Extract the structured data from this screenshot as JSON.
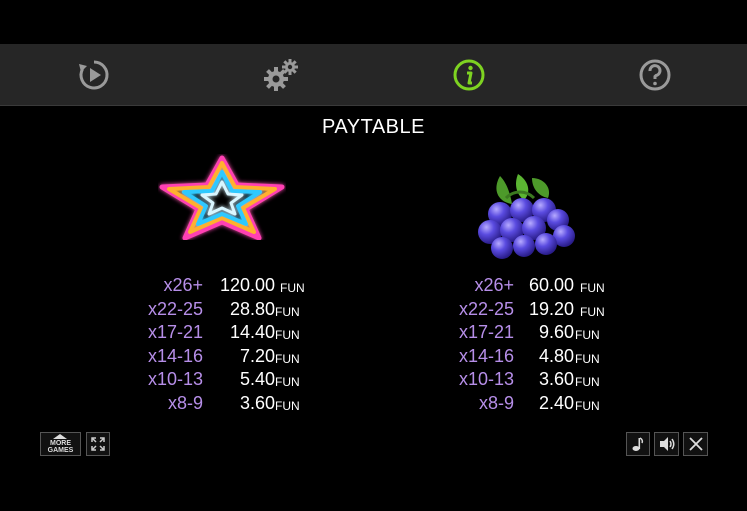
{
  "toolbar": {
    "tabs": [
      {
        "icon": "replay-icon",
        "active": false
      },
      {
        "icon": "settings-gears-icon",
        "active": false
      },
      {
        "icon": "info-icon",
        "active": true
      },
      {
        "icon": "help-icon",
        "active": false
      }
    ],
    "active_color": "#7ed321",
    "inactive_color": "#9a9a9a"
  },
  "title": "PAYTABLE",
  "currency": "FUN",
  "symbols": [
    {
      "name": "star",
      "payouts": [
        {
          "count": "x26+",
          "amount": "120.00"
        },
        {
          "count": "x22-25",
          "amount": "28.80"
        },
        {
          "count": "x17-21",
          "amount": "14.40"
        },
        {
          "count": "x14-16",
          "amount": "7.20"
        },
        {
          "count": "x10-13",
          "amount": "5.40"
        },
        {
          "count": "x8-9",
          "amount": "3.60"
        }
      ]
    },
    {
      "name": "grapes",
      "payouts": [
        {
          "count": "x26+",
          "amount": "60.00"
        },
        {
          "count": "x22-25",
          "amount": "19.20"
        },
        {
          "count": "x17-21",
          "amount": "9.60"
        },
        {
          "count": "x14-16",
          "amount": "4.80"
        },
        {
          "count": "x10-13",
          "amount": "3.60"
        },
        {
          "count": "x8-9",
          "amount": "2.40"
        }
      ]
    }
  ],
  "bottom_left": {
    "more_games_line1": "MORE",
    "more_games_line2": "GAMES"
  },
  "colors": {
    "count_text": "#b68ee8",
    "background": "#000000",
    "toolbar_bg": "#262626"
  }
}
